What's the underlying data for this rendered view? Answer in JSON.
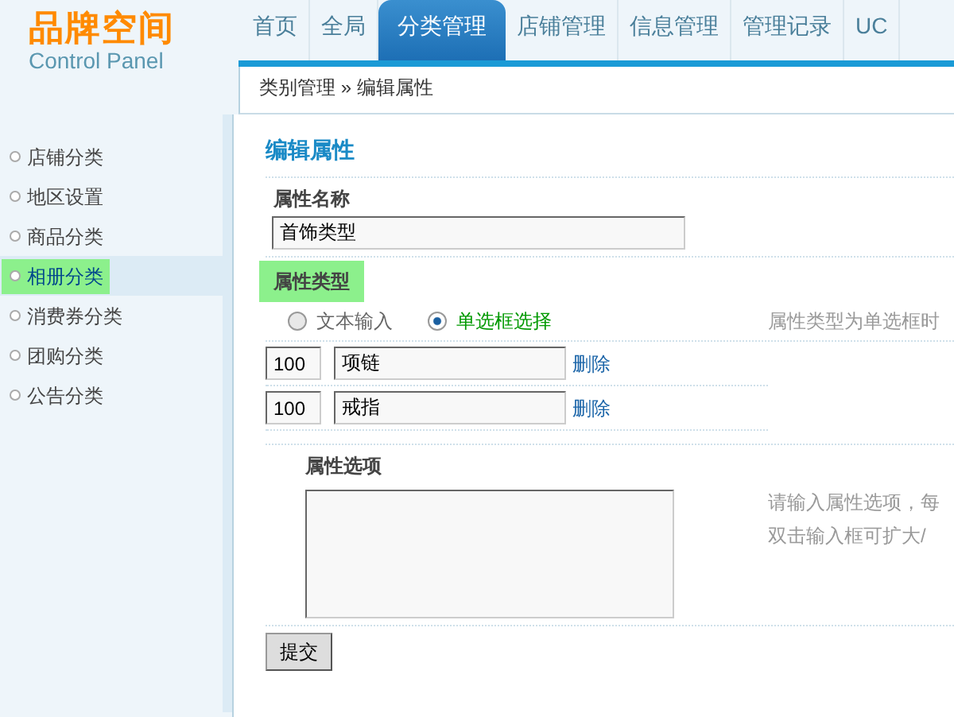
{
  "logo": {
    "title": "品牌空间",
    "subtitle": "Control Panel"
  },
  "nav": [
    {
      "label": "首页",
      "selected": false
    },
    {
      "label": "全局",
      "selected": false
    },
    {
      "label": "分类管理",
      "selected": true
    },
    {
      "label": "店铺管理",
      "selected": false
    },
    {
      "label": "信息管理",
      "selected": false
    },
    {
      "label": "管理记录",
      "selected": false
    },
    {
      "label": "UC",
      "selected": false
    }
  ],
  "breadcrumb": {
    "parent": "类别管理",
    "separator": "»",
    "current": "编辑属性"
  },
  "sidebar": {
    "items": [
      {
        "label": "店铺分类",
        "selected": false,
        "highlighted": false
      },
      {
        "label": "地区设置",
        "selected": false,
        "highlighted": false
      },
      {
        "label": "商品分类",
        "selected": false,
        "highlighted": false
      },
      {
        "label": "相册分类",
        "selected": true,
        "highlighted": true
      },
      {
        "label": "消费券分类",
        "selected": false,
        "highlighted": false
      },
      {
        "label": "团购分类",
        "selected": false,
        "highlighted": false
      },
      {
        "label": "公告分类",
        "selected": false,
        "highlighted": false
      }
    ]
  },
  "form": {
    "title": "编辑属性",
    "name_field": {
      "label": "属性名称",
      "value": "首饰类型"
    },
    "type_field": {
      "label": "属性类型",
      "highlighted": true,
      "options": [
        {
          "label": "文本输入",
          "selected": false
        },
        {
          "label": "单选框选择",
          "selected": true
        }
      ],
      "hint": "属性类型为单选框时"
    },
    "option_rows": [
      {
        "order": "100",
        "name": "项链",
        "action": "删除"
      },
      {
        "order": "100",
        "name": "戒指",
        "action": "删除"
      }
    ],
    "options_field": {
      "label": "属性选项",
      "hint_lines": [
        "请输入属性选项，每",
        "双击输入框可扩大/"
      ]
    },
    "submit": "提交"
  }
}
